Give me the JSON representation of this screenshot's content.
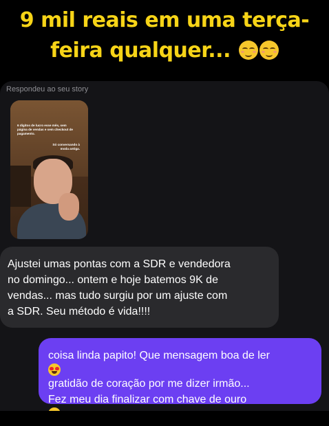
{
  "headline": {
    "line1": "9 mil reais em uma terça-",
    "line2": "feira qualquer..."
  },
  "story": {
    "label": "Respondeu ao seu story",
    "overlay_text_1": "6 dígitos de lucro esse mês, sem página de vendas e sem checkout de pagamento.",
    "overlay_text_2": "Só conversando à moda antiga."
  },
  "messages": {
    "received": {
      "lines": [
        "Ajustei umas pontas com a SDR e vendedora",
        "no domingo... ontem e hoje batemos 9K de",
        "vendas... mas tudo surgiu por um ajuste com",
        "a SDR. Seu método é vida!!!!"
      ]
    },
    "sent": {
      "line1": "coisa linda papito! Que mensagem boa de ler",
      "line2": "gratidão de coração por me dizer irmão...",
      "line3": "Fez meu dia finalizar com chave de ouro"
    }
  },
  "colors": {
    "headline": "#f7d417",
    "sent_bubble": "#6c3ff2",
    "received_bubble": "#2a2a2d"
  },
  "icons": [
    "relieved-face-emoji",
    "smirking-face-emoji",
    "heart-eyes-emoji"
  ]
}
